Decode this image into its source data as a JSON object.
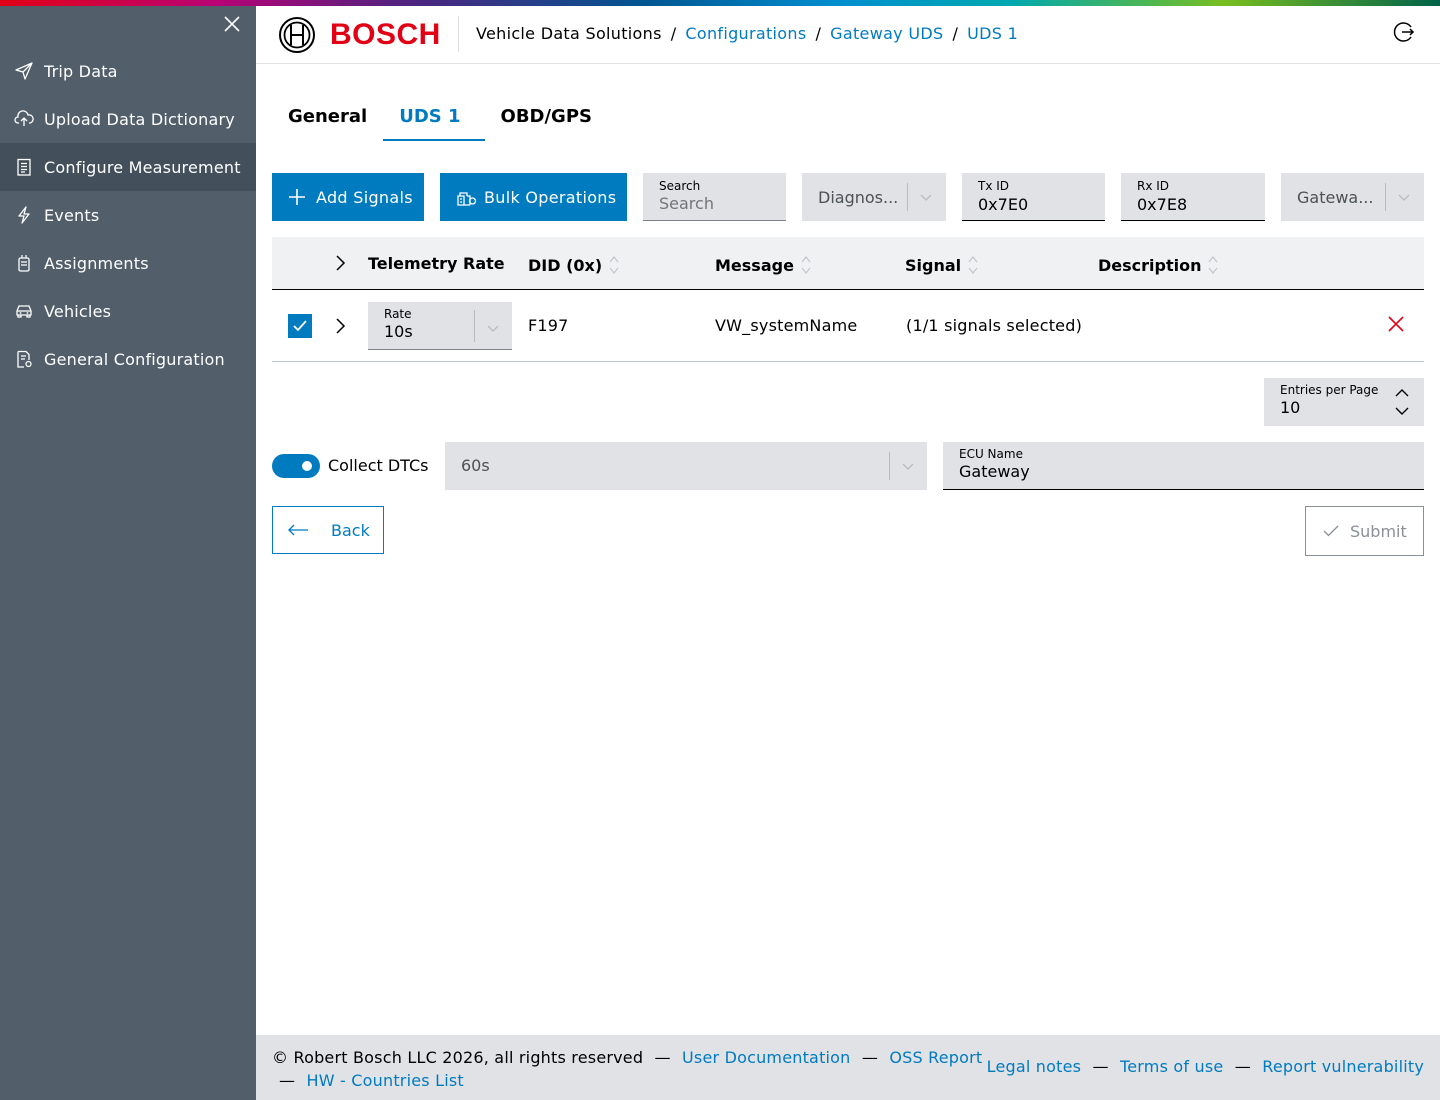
{
  "colors": {
    "brand_red": "#e20015",
    "accent_blue": "#007bc0",
    "sidebar_bg": "#525f6b",
    "sidebar_active_bg": "#43505b",
    "field_bg": "#e0e2e5",
    "delete_red": "#e20015"
  },
  "sidebar": {
    "close_icon": "close-icon",
    "items": [
      {
        "label": "Trip Data",
        "icon": "send-icon",
        "active": false
      },
      {
        "label": "Upload Data Dictionary",
        "icon": "cloud-upload-icon",
        "active": false
      },
      {
        "label": "Configure Measurement",
        "icon": "clipboard-list-icon",
        "active": true
      },
      {
        "label": "Events",
        "icon": "lightning-icon",
        "active": false
      },
      {
        "label": "Assignments",
        "icon": "device-icon",
        "active": false
      },
      {
        "label": "Vehicles",
        "icon": "car-icon",
        "active": false
      },
      {
        "label": "General Configuration",
        "icon": "document-settings-icon",
        "active": false
      }
    ]
  },
  "header": {
    "logo_text": "BOSCH",
    "breadcrumb": {
      "root": "Vehicle Data Solutions",
      "links": [
        "Configurations",
        "Gateway UDS",
        "UDS 1"
      ],
      "separator": "/"
    },
    "logout_icon": "logout-icon"
  },
  "tabs": [
    {
      "label": "General",
      "active": false
    },
    {
      "label": "UDS 1",
      "active": true
    },
    {
      "label": "OBD/GPS",
      "active": false
    }
  ],
  "toolbar": {
    "add_signals_label": "Add Signals",
    "bulk_operations_label": "Bulk Operations",
    "search": {
      "label": "Search",
      "placeholder": "Search",
      "value": ""
    },
    "diagnostic_select": {
      "value": "Diagnos..."
    },
    "tx_id": {
      "label": "Tx ID",
      "value": "0x7E0"
    },
    "rx_id": {
      "label": "Rx ID",
      "value": "0x7E8"
    },
    "gateway_select": {
      "value": "Gatewa..."
    }
  },
  "table": {
    "columns": [
      "Telemetry Rate",
      "DID (0x)",
      "Message",
      "Signal",
      "Description"
    ],
    "rows": [
      {
        "checked": true,
        "rate_label": "Rate",
        "rate_value": "10s",
        "did": "F197",
        "message": "VW_systemName",
        "signal": "(1/1 signals selected)",
        "description": ""
      }
    ]
  },
  "pagination": {
    "entries_label": "Entries per Page",
    "entries_value": "10"
  },
  "dtc": {
    "collect_label": "Collect DTCs",
    "collect_enabled": true,
    "interval_value": "60s",
    "ecu_name_label": "ECU Name",
    "ecu_name_value": "Gateway"
  },
  "actions": {
    "back_label": "Back",
    "submit_label": "Submit"
  },
  "footer": {
    "copyright": "© Robert Bosch LLC 2026, all rights reserved",
    "separator": "—",
    "left_links": [
      "User Documentation",
      "OSS Report",
      "HW - Countries List"
    ],
    "right_links": [
      "Legal notes",
      "Terms of use",
      "Report vulnerability"
    ]
  }
}
